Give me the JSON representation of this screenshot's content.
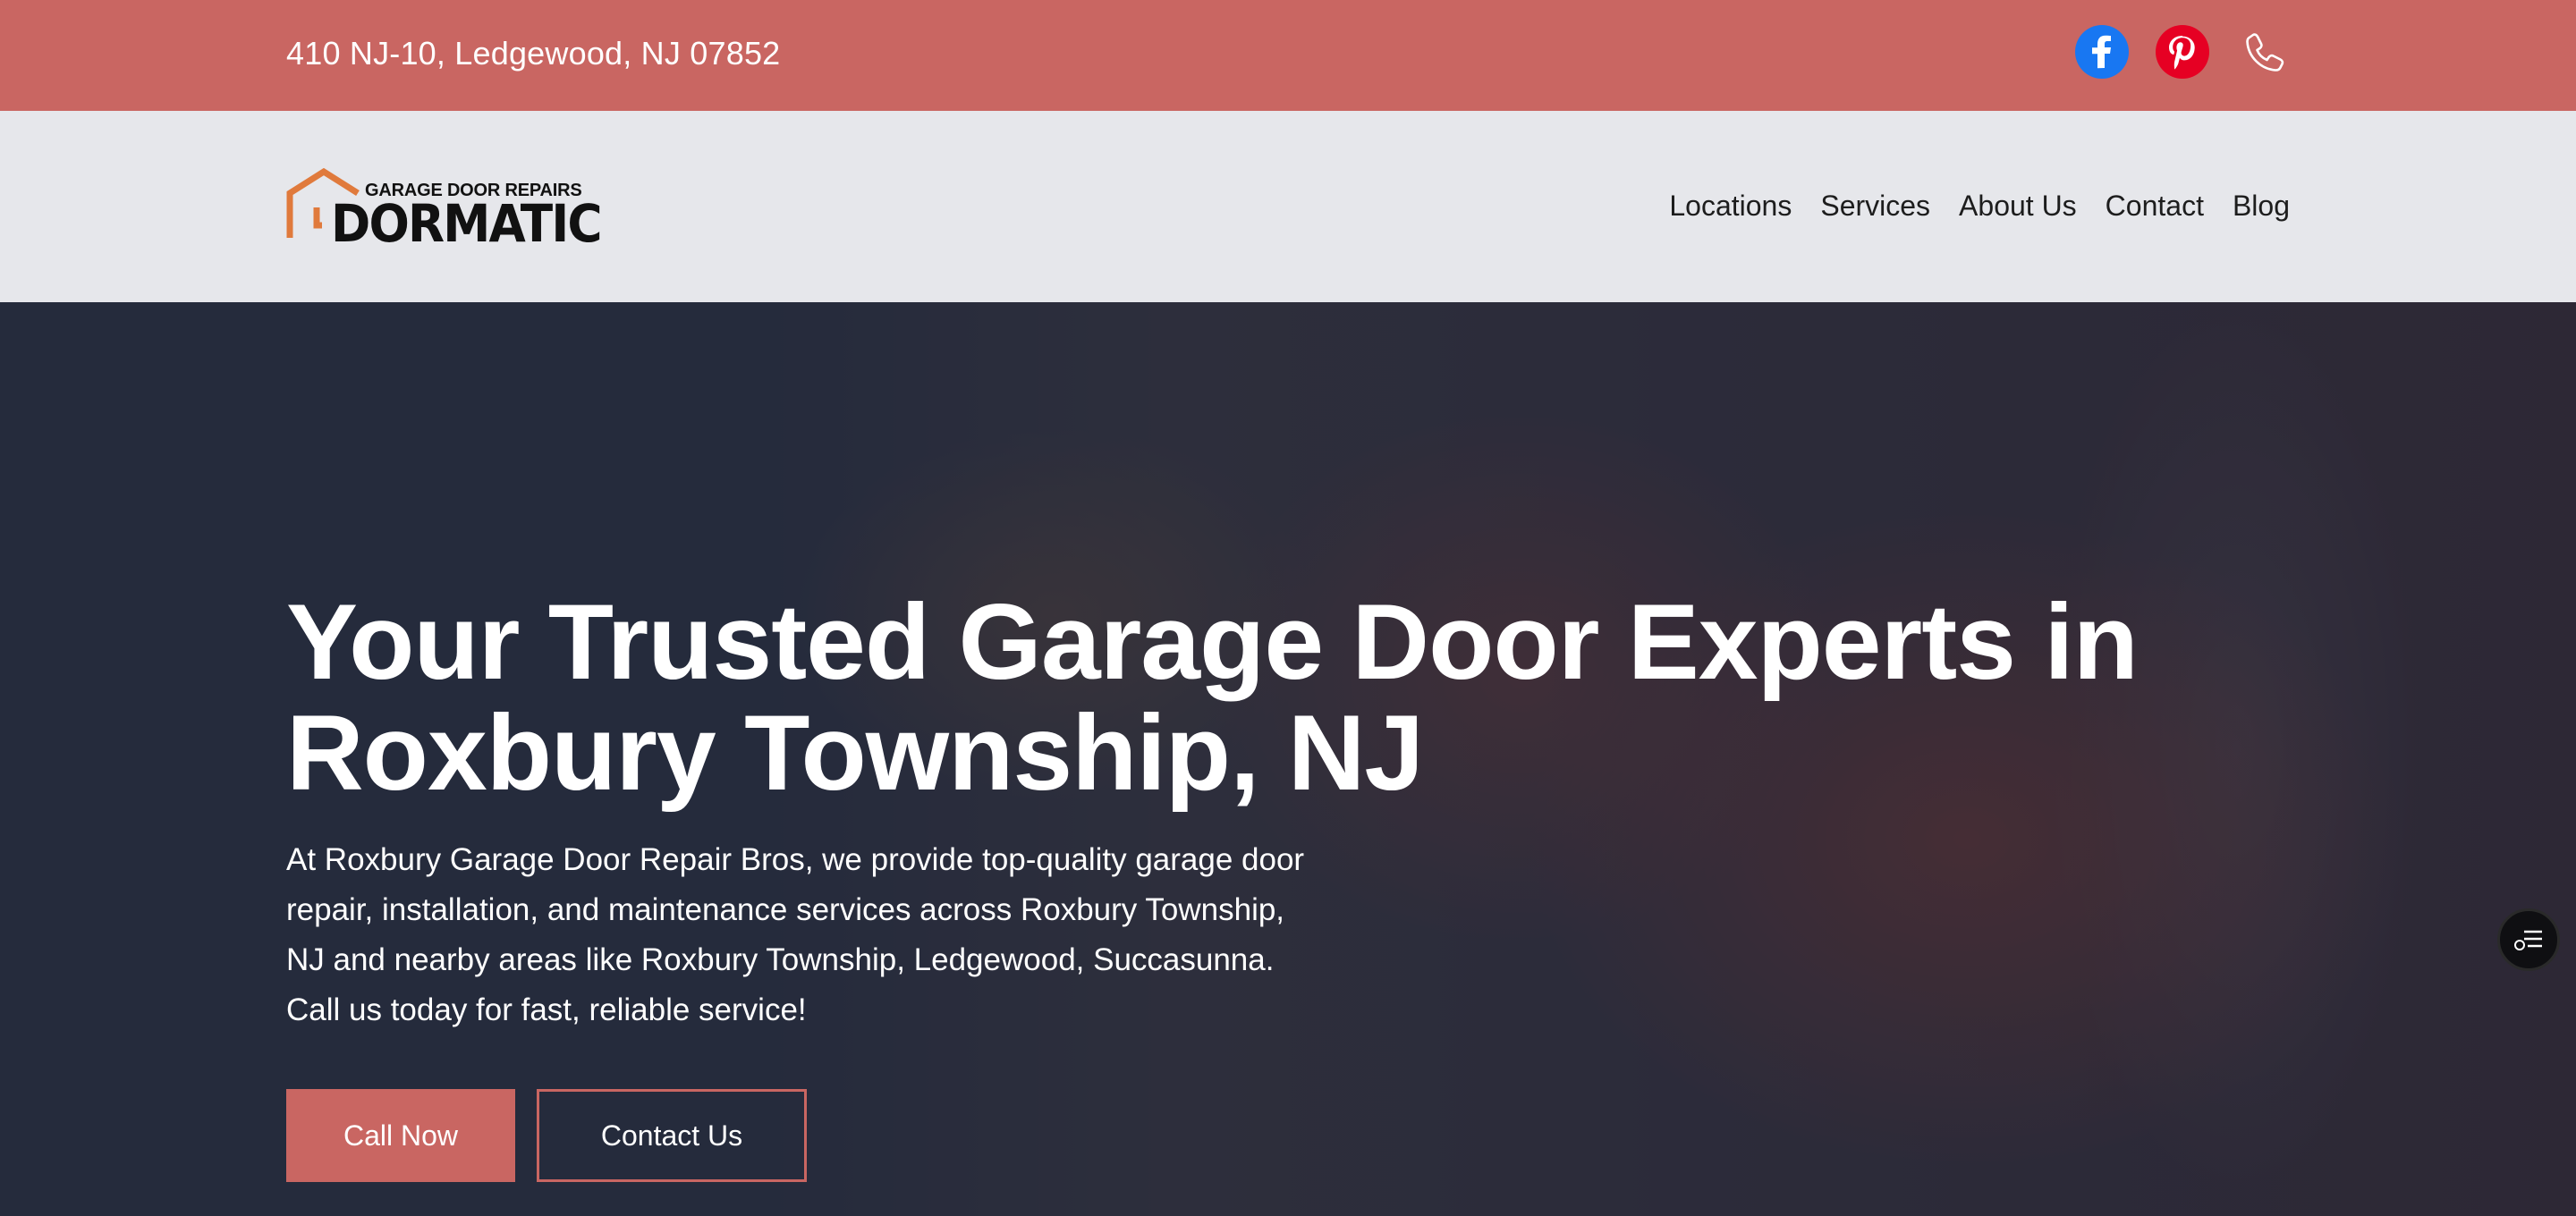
{
  "topbar": {
    "address": "410 NJ-10, Ledgewood, NJ 07852",
    "social": [
      {
        "icon": "facebook-icon",
        "color": "#1877f2"
      },
      {
        "icon": "pinterest-icon",
        "color": "#e60023"
      },
      {
        "icon": "phone-icon",
        "color": "#ffffff"
      }
    ]
  },
  "header": {
    "logo_small": "GARAGE DOOR REPAIRS",
    "logo_big": "DORMATIC",
    "logo_color": "#e07a3c",
    "nav": [
      "Locations",
      "Services",
      "About Us",
      "Contact",
      "Blog"
    ]
  },
  "hero": {
    "title": "Your Trusted Garage Door Experts in Roxbury Township, NJ",
    "description": "At Roxbury Garage Door Repair Bros, we provide top-quality garage door repair, installation, and maintenance services across Roxbury Township, NJ and nearby areas like Roxbury Township, Ledgewood, Succasunna. Call us today for fast, reliable service!",
    "call_button": "Call Now",
    "contact_button": "Contact Us"
  },
  "colors": {
    "accent": "#c96662",
    "nav_bg": "#e6e7eb",
    "hero_bg": "#232938"
  }
}
